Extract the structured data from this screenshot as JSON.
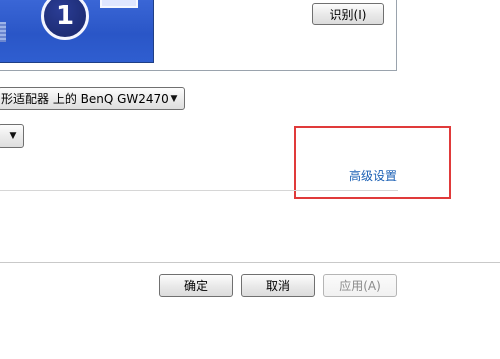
{
  "preview": {
    "monitor_number": "1"
  },
  "identify_button": {
    "label": "识别(I)"
  },
  "display_select": {
    "value": "形适配器 上的 BenQ GW2470"
  },
  "advanced_link": {
    "label": "高级设置"
  },
  "buttons": {
    "ok": "确定",
    "cancel": "取消",
    "apply": "应用(A)"
  },
  "colors": {
    "link": "#1a5fb4",
    "highlight": "#e03a3a",
    "preview_bg": "#2a56c7"
  }
}
